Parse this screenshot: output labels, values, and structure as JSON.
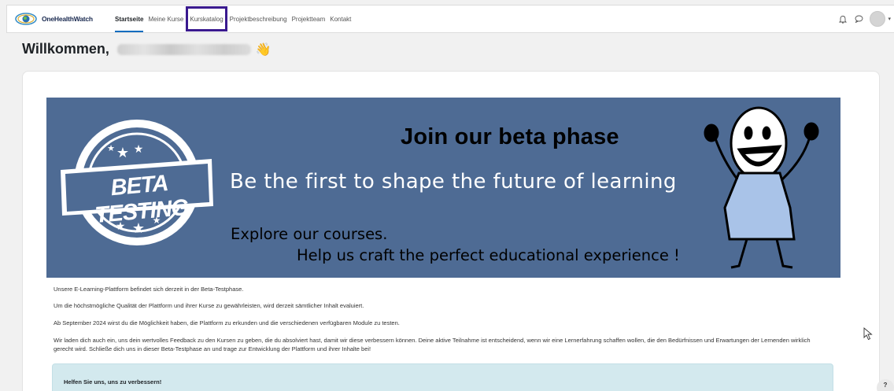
{
  "brand": {
    "name": "OneHealthWatch"
  },
  "nav": {
    "items": [
      {
        "label": "Startseite",
        "active": true,
        "highlighted": false
      },
      {
        "label": "Meine Kurse",
        "active": false,
        "highlighted": false
      },
      {
        "label": "Kurskatalog",
        "active": false,
        "highlighted": true
      },
      {
        "label": "Projektbeschreibung",
        "active": false,
        "highlighted": false
      },
      {
        "label": "Projektteam",
        "active": false,
        "highlighted": false
      },
      {
        "label": "Kontakt",
        "active": false,
        "highlighted": false
      }
    ],
    "icons": [
      "bell-icon",
      "chat-icon",
      "user-avatar",
      "chevron-down-icon"
    ],
    "highlight_color": "#3a1a8f",
    "active_color": "#0f6cbf"
  },
  "welcome": {
    "text": "Willkommen,",
    "emoji": "👋"
  },
  "banner": {
    "badge_text": "BETA TESTING",
    "title": "Join our beta phase",
    "subtitle": "Be the first to shape the future of learning",
    "line1": "Explore our courses.",
    "line2": "Help us craft the perfect educational experience !",
    "bg_color": "#4e6b94"
  },
  "paragraphs": [
    "Unsere E-Learning-Plattform befindet sich derzeit in der Beta-Testphase.",
    "Um die höchstmögliche Qualität der Plattform und ihrer Kurse zu gewährleisten, wird derzeit sämtlicher Inhalt evaluiert.",
    "Ab September 2024 wirst du die Möglichkeit haben, die Plattform zu erkunden und die verschiedenen verfügbaren Module zu testen.",
    "Wir laden dich auch ein, uns dein wertvolles Feedback zu den Kursen zu geben, die du absolviert hast, damit wir diese verbessern können. Deine aktive Teilnahme ist entscheidend, wenn wir eine Lernerfahrung schaffen wollen, die den Bedürfnissen und Erwartungen der Lernenden wirklich gerecht wird. Schließe dich uns in dieser Beta-Testphase an und trage zur Entwicklung der Plattform und ihrer Inhalte bei!"
  ],
  "infobox": {
    "title": "Helfen Sie uns, uns zu verbessern!",
    "bg_color": "#d3e9ee"
  },
  "help": {
    "label": "?"
  }
}
